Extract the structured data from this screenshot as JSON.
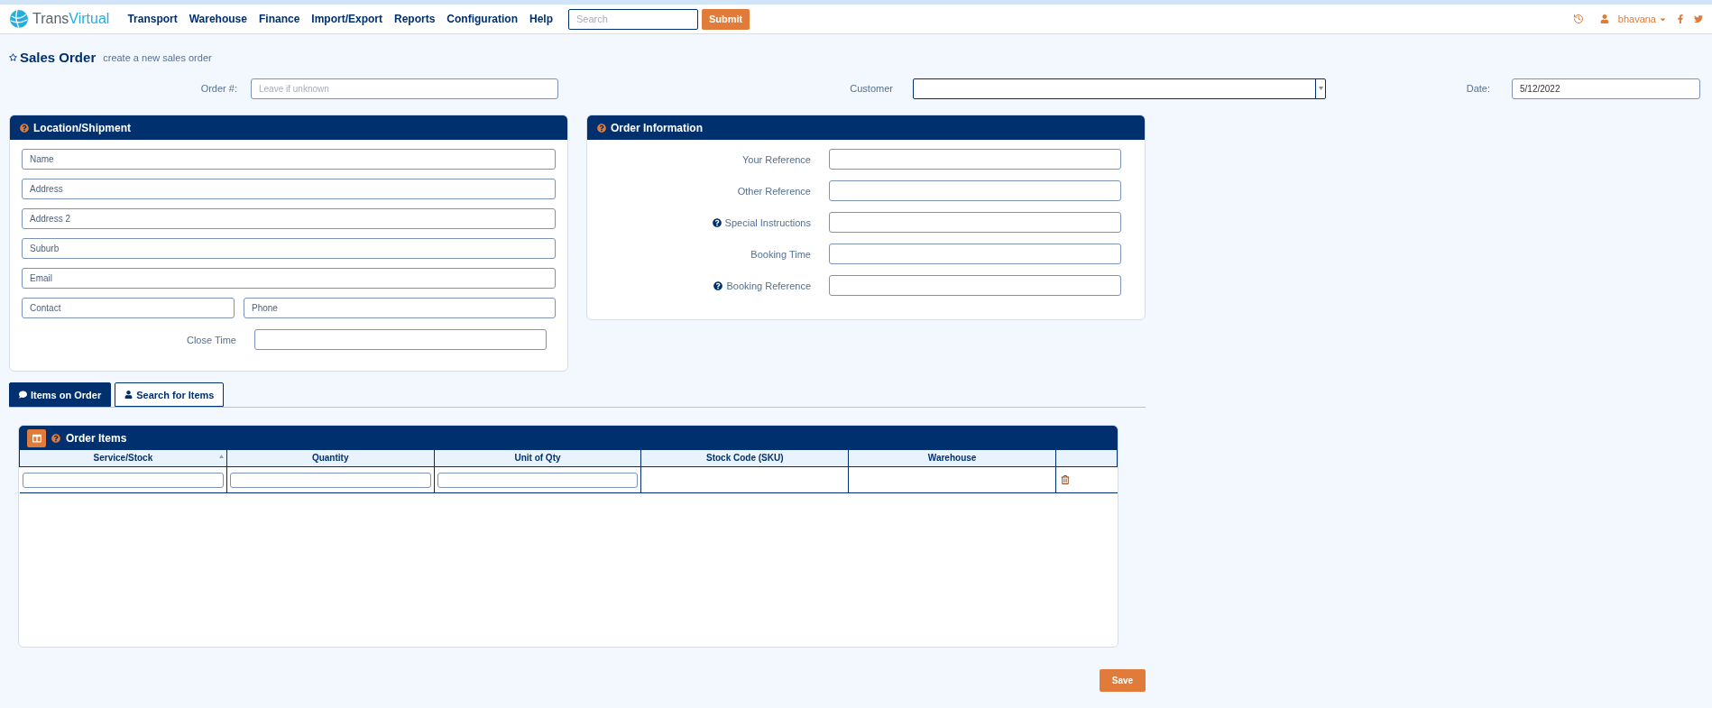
{
  "nav": {
    "brand": [
      "Trans",
      "Virtual"
    ],
    "menu": [
      "Transport",
      "Warehouse",
      "Finance",
      "Import/Export",
      "Reports",
      "Configuration",
      "Help"
    ],
    "search": {
      "placeholder": "Search"
    },
    "submit": "Submit",
    "user": "bhavana"
  },
  "page": {
    "title": "Sales Order",
    "subtitle": "create a new sales order"
  },
  "order_number": {
    "label": "Order #:",
    "placeholder": "Leave if unknown"
  },
  "customer": {
    "label": "Customer"
  },
  "date": {
    "label": "Date:",
    "value": "5/12/2022"
  },
  "location": {
    "title": "Location/Shipment",
    "rows": [
      [
        {
          "placeholder": "Name"
        }
      ],
      [
        {
          "placeholder": "Address"
        }
      ],
      [
        {
          "placeholder": "Address 2"
        }
      ],
      [
        {
          "placeholder": "Suburb"
        }
      ],
      [
        {
          "placeholder": "Email"
        }
      ],
      [
        {
          "placeholder": "Contact"
        },
        {
          "placeholder": "Phone"
        }
      ]
    ],
    "close_time": {
      "label": "Close Time"
    }
  },
  "order_info": {
    "title": "Order Information",
    "fields": [
      {
        "label": "Your Reference",
        "help": false
      },
      {
        "label": "Other Reference",
        "help": false
      },
      {
        "label": "Special Instructions",
        "help": true
      },
      {
        "label": "Booking Time",
        "help": false
      },
      {
        "label": "Booking Reference",
        "help": true
      }
    ]
  },
  "tabs": [
    {
      "label": "Items on Order",
      "kind": "comment",
      "selected": true
    },
    {
      "label": "Search for Items",
      "kind": "user",
      "selected": false
    }
  ],
  "order_items": {
    "title": "Order Items",
    "columns": [
      {
        "label": "Service/Stock",
        "sorted": true
      },
      {
        "label": "Quantity",
        "sorted": false
      },
      {
        "label": "Unit of Qty",
        "sorted": false
      },
      {
        "label": "Stock Code (SKU)",
        "sorted": false
      },
      {
        "label": "Warehouse",
        "sorted": false
      },
      {
        "sorted": false
      }
    ],
    "rows": [
      {
        "cells": [
          {
            "kind": "input"
          },
          {
            "kind": "input"
          },
          {
            "kind": "input"
          },
          {
            "kind": "empty"
          },
          {
            "kind": "empty"
          },
          {
            "kind": "delete"
          }
        ]
      }
    ]
  },
  "save": "Save"
}
